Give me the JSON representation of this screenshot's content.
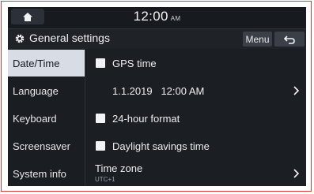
{
  "status": {
    "time": "12:00",
    "ampm": "AM"
  },
  "header": {
    "title": "General settings",
    "menu_label": "Menu"
  },
  "sidebar": {
    "items": [
      {
        "label": "Date/Time",
        "active": true
      },
      {
        "label": "Language",
        "active": false
      },
      {
        "label": "Keyboard",
        "active": false
      },
      {
        "label": "Screensaver",
        "active": false
      },
      {
        "label": "System info",
        "active": false
      }
    ]
  },
  "settings": {
    "gps_time": {
      "label": "GPS time",
      "checked": false
    },
    "date_time_value": "1.1.2019   12:00 AM",
    "hour24": {
      "label": "24-hour format",
      "checked": false
    },
    "daylight": {
      "label": "Daylight savings time",
      "checked": false
    },
    "time_zone": {
      "label": "Time zone",
      "value": "UTC+1"
    }
  },
  "icons": {
    "home": "home-icon",
    "settings": "gear-icon",
    "back": "back-arrow-icon",
    "chevron": "chevron-right-icon"
  },
  "colors": {
    "background": "#1b1e23",
    "active_item": "#d8dde5",
    "button": "#3b4048",
    "frame_border": "#d23b3b"
  }
}
